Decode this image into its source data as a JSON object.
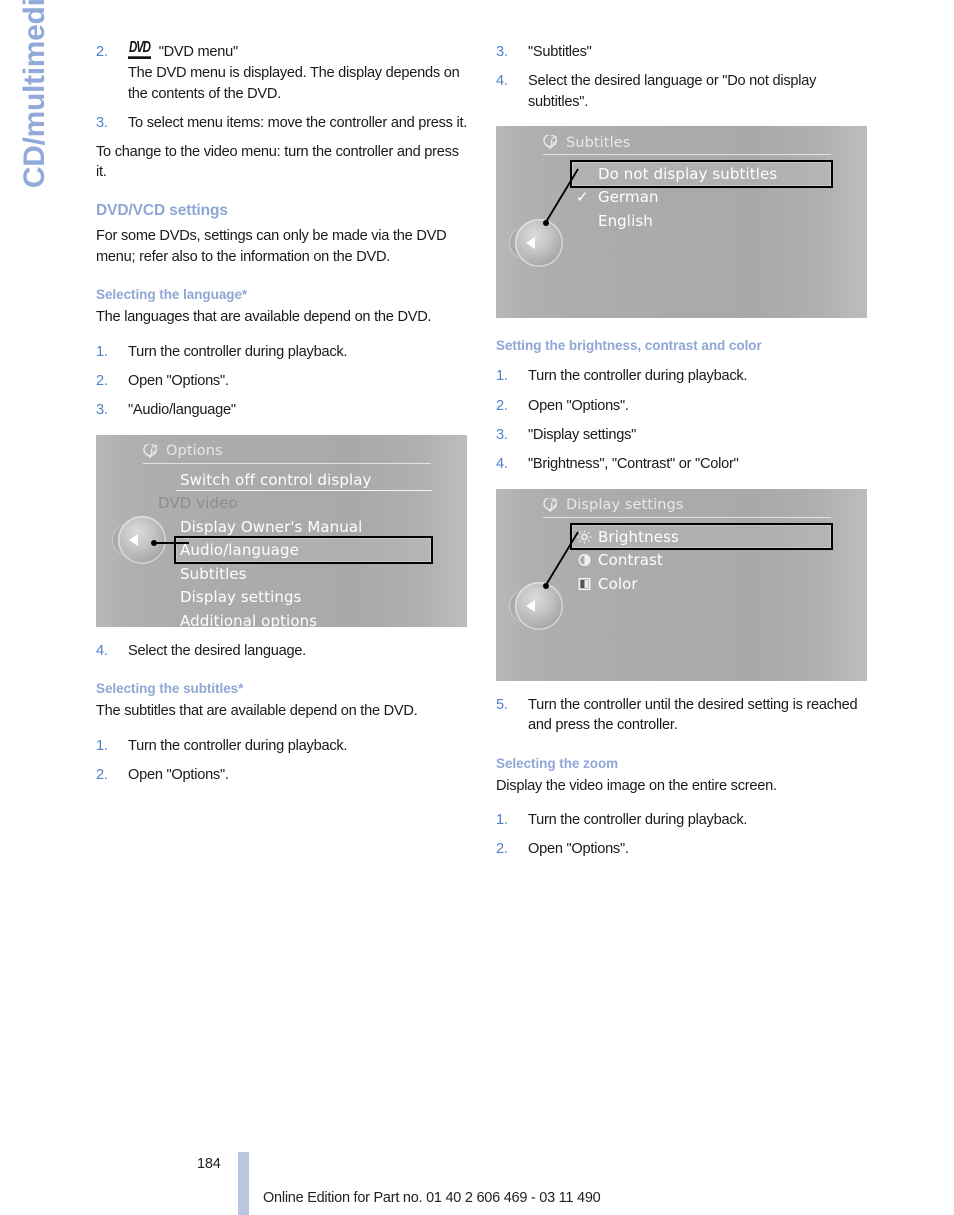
{
  "chapter": {
    "label": "CD/multimedia",
    "color": "#92aad9"
  },
  "footer": {
    "page_number": "184",
    "note": "Online Edition for Part no. 01 40 2 606 469 - 03 11 490",
    "bar_color": "#b9c6e2"
  },
  "left_column": {
    "steps_top": [
      {
        "num": "2.",
        "icon": "dvd-logo-icon",
        "logo": "DVD",
        "text": "\"DVD menu\"",
        "sub": "The DVD menu is displayed. The display depends on the contents of the DVD."
      },
      {
        "num": "3.",
        "text": "To select menu items: move the controller and press it."
      }
    ],
    "paragraph_video_menu": "To change to the video menu: turn the controller and press it.",
    "heading_settings": "DVD/VCD settings",
    "paragraph_settings": "For some DVDs, settings can only be made via the DVD menu; refer also to the information on the DVD.",
    "heading_language": "Selecting the language*",
    "paragraph_language": "The languages that are available depend on the DVD.",
    "steps_language": [
      {
        "num": "1.",
        "text": "Turn the controller during playback."
      },
      {
        "num": "2.",
        "text": "Open \"Options\"."
      },
      {
        "num": "3.",
        "text": "\"Audio/language\""
      }
    ],
    "step_language_4": {
      "num": "4.",
      "text": "Select the desired language."
    },
    "heading_subtitles": "Selecting the subtitles*",
    "paragraph_subtitles": "The subtitles that are available depend on the DVD.",
    "steps_subtitles": [
      {
        "num": "1.",
        "text": "Turn the controller during playback."
      },
      {
        "num": "2.",
        "text": "Open \"Options\"."
      }
    ]
  },
  "right_column": {
    "steps_top": [
      {
        "num": "3.",
        "text": "\"Subtitles\""
      },
      {
        "num": "4.",
        "text": "Select the desired language or \"Do not display subtitles\"."
      }
    ],
    "heading_brightness": "Setting the brightness, contrast and color",
    "steps_brightness": [
      {
        "num": "1.",
        "text": "Turn the controller during playback."
      },
      {
        "num": "2.",
        "text": "Open \"Options\"."
      },
      {
        "num": "3.",
        "text": "\"Display settings\""
      },
      {
        "num": "4.",
        "text": "\"Brightness\", \"Contrast\" or \"Color\""
      }
    ],
    "step_brightness_5": {
      "num": "5.",
      "text": "Turn the controller until the desired setting is reached and press the controller."
    },
    "heading_zoom": "Selecting the zoom",
    "paragraph_zoom": "Display the video image on the entire screen.",
    "steps_zoom": [
      {
        "num": "1.",
        "text": "Turn the controller during playback."
      },
      {
        "num": "2.",
        "text": "Open \"Options\"."
      }
    ]
  },
  "screens": {
    "options": {
      "title": "Options",
      "title_icon": "options-icon",
      "rows": [
        {
          "label": "Switch off control display",
          "state": "normal"
        },
        {
          "label": "DVD video",
          "state": "dimmed"
        },
        {
          "label": "Display Owner's Manual",
          "state": "normal"
        },
        {
          "label": "Audio/language",
          "state": "selected"
        },
        {
          "label": "Subtitles",
          "state": "normal"
        },
        {
          "label": "Display settings",
          "state": "normal"
        },
        {
          "label": "Additional options",
          "state": "normal"
        }
      ]
    },
    "subtitles": {
      "title": "Subtitles",
      "title_icon": "options-icon",
      "rows": [
        {
          "label": "Do not display subtitles",
          "state": "selected",
          "check": ""
        },
        {
          "label": "German",
          "state": "normal",
          "check": "✓"
        },
        {
          "label": "English",
          "state": "normal",
          "check": ""
        }
      ]
    },
    "display_settings": {
      "title": "Display settings",
      "title_icon": "options-icon",
      "rows": [
        {
          "label": "Brightness",
          "state": "selected",
          "icon": "sun-icon"
        },
        {
          "label": "Contrast",
          "state": "normal",
          "icon": "contrast-icon"
        },
        {
          "label": "Color",
          "state": "normal",
          "icon": "color-icon"
        }
      ]
    }
  }
}
